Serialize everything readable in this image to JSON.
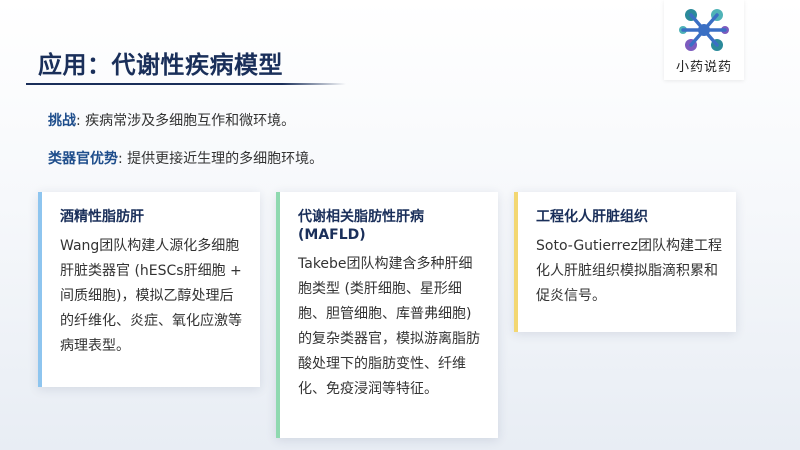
{
  "slide": {
    "title": "应用：代谢性疾病模型"
  },
  "logo": {
    "text": "小药说药",
    "icon": "molecule-logo-icon",
    "colors": [
      "#2b8a9a",
      "#4fb3b7",
      "#7d5bbe",
      "#3a6fc4"
    ]
  },
  "points": [
    {
      "label": "挑战",
      "text": ": 疾病常涉及多细胞互作和微环境。"
    },
    {
      "label": "类器官优势",
      "text": ": 提供更接近生理的多细胞环境。"
    }
  ],
  "cards": [
    {
      "title": "酒精性脂肪肝",
      "body": "Wang团队构建人源化多细胞肝脏类器官 (hESCs肝细胞 + 间质细胞)，模拟乙醇处理后的纤维化、炎症、氧化应激等病理表型。",
      "accent": "#8ec5ef"
    },
    {
      "title": "代谢相关脂肪性肝病 (MAFLD)",
      "body": "Takebe团队构建含多种肝细胞类型 (类肝细胞、星形细胞、胆管细胞、库普弗细胞) 的复杂类器官，模拟游离脂肪酸处理下的脂肪变性、纤维化、免疫浸润等特征。",
      "accent": "#8fd9b0"
    },
    {
      "title": "工程化人肝脏组织",
      "body": "Soto-Gutierrez团队构建工程化人肝脏组织模拟脂滴积累和促炎信号。",
      "accent": "#f3d772"
    }
  ]
}
